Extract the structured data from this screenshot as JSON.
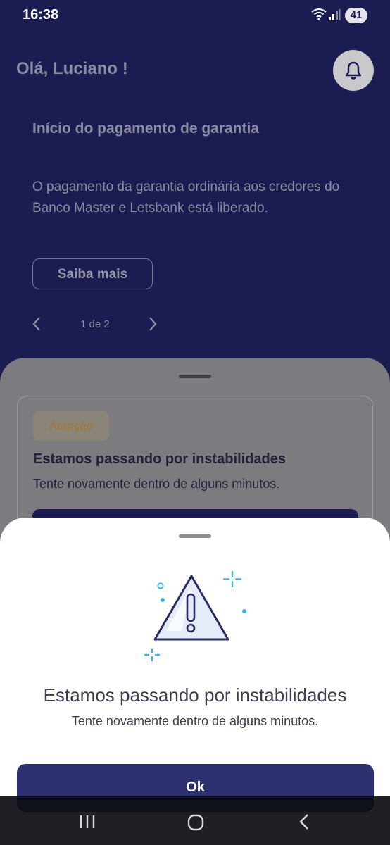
{
  "status_bar": {
    "time": "16:38",
    "battery": "41"
  },
  "header": {
    "greeting": "Olá, Luciano !"
  },
  "banner": {
    "title": "Início do pagamento de garantia",
    "text": "O pagamento da garantia ordinária aos credores do Banco Master e Letsbank está liberado.",
    "button_label": "Saiba mais",
    "pager_text": "1 de 2"
  },
  "alert_card": {
    "badge": "Atenção",
    "title": "Estamos passando por instabilidades",
    "text": "Tente novamente dentro de alguns minutos."
  },
  "modal": {
    "title": "Estamos passando por instabilidades",
    "text": "Tente novamente dentro de alguns minutos.",
    "ok_label": "Ok"
  },
  "colors": {
    "primary": "#1b1d52",
    "button": "#2e3170",
    "accent": "#3fb3e0",
    "badge_text": "#a07a2c"
  }
}
